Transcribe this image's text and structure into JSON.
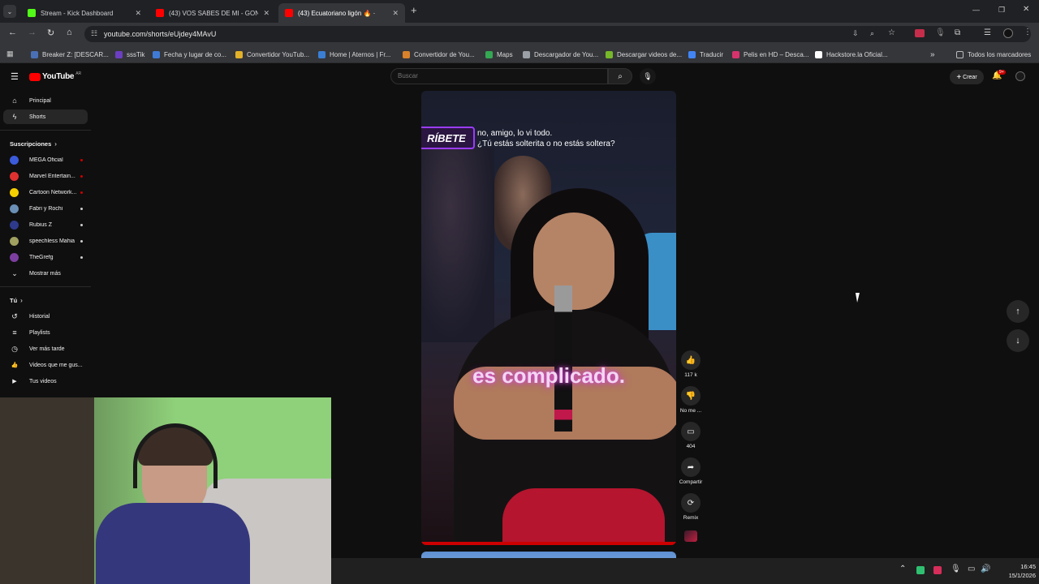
{
  "browser": {
    "tabs": [
      {
        "title": "Stream - Kick Dashboard",
        "color": "#53fc18",
        "active": false
      },
      {
        "title": "(43) VOS SABES DE MI - GONZ",
        "color": "#ff0000",
        "active": false
      },
      {
        "title": "(43) Ecuatoriano ligón 🔥 ·",
        "color": "#ff0000",
        "active": true
      }
    ],
    "new_tab": "+",
    "url": "youtube.com/shorts/eUjdey4MAvU",
    "bookmarks": [
      {
        "label": "Breaker Z: [DESCAR...",
        "color": "#4a6fb5"
      },
      {
        "label": "sssTik",
        "color": "#6c3fc0"
      },
      {
        "label": "Fecha y lugar de co...",
        "color": "#3f7bd6"
      },
      {
        "label": "Convertidor YouTub...",
        "color": "#e2b12a"
      },
      {
        "label": "Home | Aternos | Fr...",
        "color": "#3a7fd4"
      },
      {
        "label": "Convertidor de You...",
        "color": "#d9822b"
      },
      {
        "label": "Maps",
        "color": "#34a853"
      },
      {
        "label": "Descargador de You...",
        "color": "#9aa0a6"
      },
      {
        "label": "Descargar videos de...",
        "color": "#76b82a"
      },
      {
        "label": "Traducir",
        "color": "#4285f4"
      },
      {
        "label": "Pelis en HD – Desca...",
        "color": "#d6336c"
      },
      {
        "label": "Hackstore.la Oficial...",
        "color": "#ffffff"
      }
    ],
    "more_bookmarks": "»",
    "all_bookmarks": "Todos los marcadores"
  },
  "youtube": {
    "logo": "YouTube",
    "region": "AR",
    "search_placeholder": "Buscar",
    "create_label": "Crear",
    "notif_count": "9+",
    "sidebar": {
      "main": [
        {
          "label": "Principal",
          "icon": "home-icon",
          "glyph": "⌂"
        },
        {
          "label": "Shorts",
          "icon": "shorts-icon",
          "glyph": "ϟ"
        }
      ],
      "subs_title": "Suscripciones",
      "subscriptions": [
        {
          "label": "MEGA Oficial",
          "color": "#3b5bdb",
          "dot": "#cc0000"
        },
        {
          "label": "Marvel Entertain...",
          "color": "#e03131",
          "dot": "#cc0000"
        },
        {
          "label": "Cartoon Network...",
          "color": "#f5d000",
          "dot": "#cc0000"
        },
        {
          "label": "Fabri y Rochi",
          "color": "#6b8fb5",
          "dot": "#cfcfcf"
        },
        {
          "label": "Rubius Z",
          "color": "#2e3a8c",
          "dot": "#cfcfcf"
        },
        {
          "label": "speechless Mahia",
          "color": "#a0a060",
          "dot": "#cfcfcf"
        },
        {
          "label": "TheGrefg",
          "color": "#7b3fa0",
          "dot": "#cfcfcf"
        }
      ],
      "show_more": "Mostrar más",
      "you_title": "Tú",
      "you_items": [
        {
          "label": "Historial",
          "icon": "history-icon",
          "glyph": "↺"
        },
        {
          "label": "Playlists",
          "icon": "playlists-icon",
          "glyph": "≡"
        },
        {
          "label": "Ver más tarde",
          "icon": "watch-later-icon",
          "glyph": "◷"
        },
        {
          "label": "Videos que me gus...",
          "icon": "liked-icon",
          "glyph": "👍"
        },
        {
          "label": "Tus videos",
          "icon": "your-videos-icon",
          "glyph": "▶"
        }
      ]
    },
    "short": {
      "subscribe_badge": "RÍBETE",
      "caption_line1": "no, amigo, lo vi todo.",
      "caption_line2": "¿Tú estás solterita o no estás soltera?",
      "big_caption": "es complicado.",
      "actions": [
        {
          "label": "117 k",
          "icon": "like-icon",
          "glyph": "👍"
        },
        {
          "label": "No me ...",
          "icon": "dislike-icon",
          "glyph": "👎"
        },
        {
          "label": "404",
          "icon": "comment-icon",
          "glyph": "▭"
        },
        {
          "label": "Compartir",
          "icon": "share-icon",
          "glyph": "➦"
        },
        {
          "label": "Remix",
          "icon": "remix-icon",
          "glyph": "⟳"
        }
      ]
    }
  },
  "taskbar": {
    "time": "16:45",
    "date": "15/1/2026"
  }
}
